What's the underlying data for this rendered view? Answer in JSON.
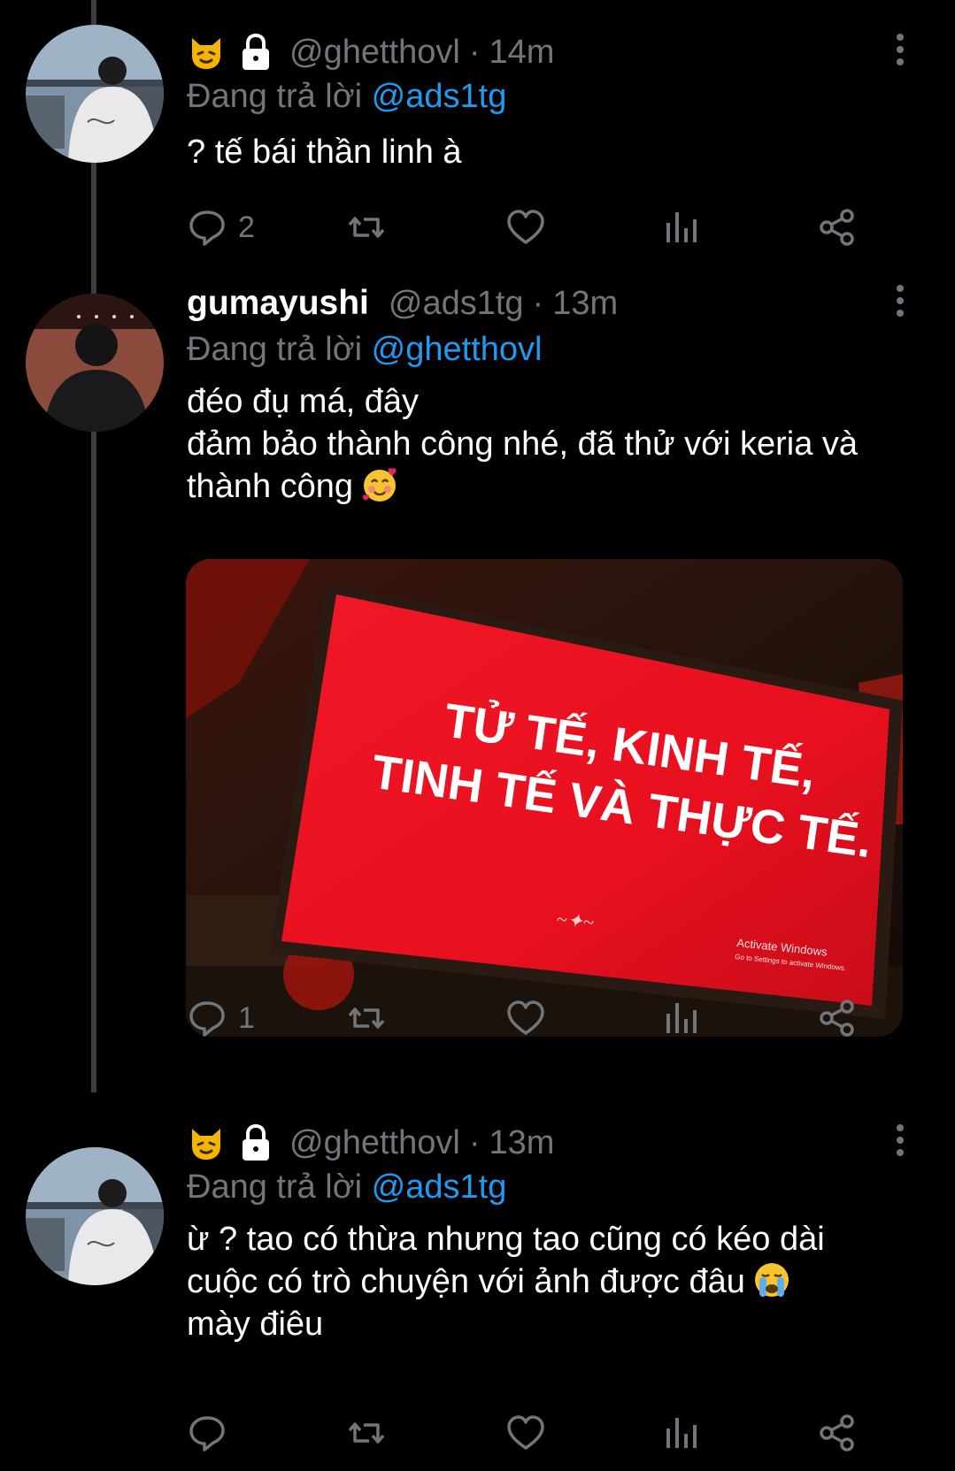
{
  "tweets": [
    {
      "display_name": "",
      "handle": "@ghetthovl",
      "separator": "·",
      "time": "14m",
      "replying_prefix": "Đang trả lời",
      "replying_to": "@ads1tg",
      "lines": [
        "? tế bái thần linh à"
      ],
      "reply_count": "2",
      "badges": [
        "cat-emoji",
        "lock-icon"
      ]
    },
    {
      "display_name": "gumayushi",
      "handle": "@ads1tg",
      "separator": "·",
      "time": "13m",
      "replying_prefix": "Đang trả lời",
      "replying_to": "@ghetthovl",
      "lines": [
        "đéo đụ má, đây",
        "đảm bảo thành công nhé, đã thử với keria và",
        "thành công"
      ],
      "reply_count": "1",
      "media": {
        "sign_line1": "TỬ TẾ, KINH TẾ,",
        "sign_line2": "TINH TẾ VÀ THỰC TẾ.",
        "watermark_line1": "Activate Windows",
        "watermark_line2": "Go to Settings to activate Windows.",
        "sign_color": "#e8101f"
      }
    },
    {
      "display_name": "",
      "handle": "@ghetthovl",
      "separator": "·",
      "time": "13m",
      "replying_prefix": "Đang trả lời",
      "replying_to": "@ads1tg",
      "lines": [
        "ừ ? tao có thừa nhưng tao cũng có kéo dài",
        "cuộc có trò chuyện với ảnh được đâu",
        "mày điêu"
      ],
      "reply_count": "",
      "badges": [
        "cat-emoji",
        "lock-icon"
      ]
    }
  ],
  "colors": {
    "background": "#000000",
    "text": "#ffffff",
    "secondary": "#71767b",
    "accent": "#1d9bf0",
    "thread_line": "#3a3d40"
  },
  "icons": [
    "reply-icon",
    "retweet-icon",
    "like-icon",
    "views-icon",
    "share-icon",
    "more-icon"
  ]
}
